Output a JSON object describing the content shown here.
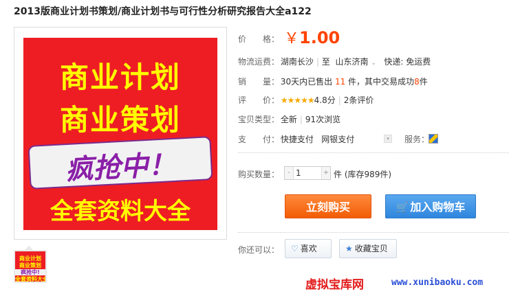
{
  "product": {
    "title": "2013版商业计划书策划/商业计划书与可行性分析研究报告大全a122"
  },
  "image": {
    "line1": "商业计划",
    "line2": "商业策划",
    "line3": "疯抢中！",
    "line4": "全套资料大全"
  },
  "thumbnail": {
    "line1": "商业计划",
    "line2": "商业策划",
    "line3": "疯抢中!",
    "line4": "全套资料大全"
  },
  "price": {
    "label": "价　　格：",
    "currency": "￥",
    "value": "1.00"
  },
  "shipping": {
    "label": "物流运费：",
    "from": "湖南长沙",
    "to_prefix": "至",
    "to": "山东济南",
    "dropdown": "⌄",
    "fee": "快递: 免运费"
  },
  "sales": {
    "label": "销　　量：",
    "prefix": "30天内已售出",
    "sold": "11",
    "mid": "件，其中交易成功",
    "success": "8",
    "suffix": "件"
  },
  "review": {
    "label": "评　　价：",
    "stars": "★★★★★",
    "score": "4.8分",
    "count_text": "2条评价"
  },
  "item_type": {
    "label": "宝贝类型：",
    "condition": "全新",
    "views": "91次浏览"
  },
  "payment": {
    "label": "支　　付：",
    "method1": "快捷支付",
    "method2": "网银支付",
    "service_label": "服务："
  },
  "quantity": {
    "label": "购买数量：",
    "minus": "-",
    "plus": "+",
    "value": "1",
    "stock": "件 (库存989件)"
  },
  "buttons": {
    "buy_now": "立刻购买",
    "add_cart": "加入购物车",
    "more_label": "你还可以：",
    "like": "喜欢",
    "favorite": "收藏宝贝"
  },
  "watermark": {
    "text": "虚拟宝库网",
    "url": "www.xunibaoku.com"
  },
  "colors": {
    "price": "#ff4400",
    "buy_button": "#f25c05",
    "cart_button": "#2f86dd",
    "image_bg": "#ee1d24",
    "image_text": "#ffff00"
  }
}
